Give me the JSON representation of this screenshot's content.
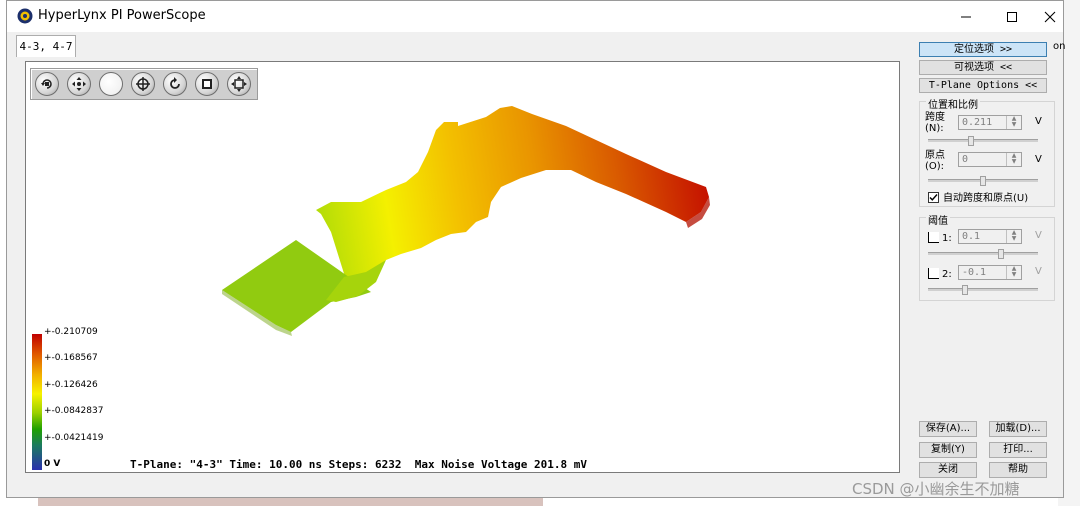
{
  "window": {
    "title": "HyperLynx PI PowerScope"
  },
  "tabs": [
    {
      "label": "4-3, 4-7"
    }
  ],
  "toolbar": {
    "tools": [
      "rotate-icon",
      "pan-icon",
      "blank-icon",
      "move-icon",
      "reset-view-icon",
      "stop-icon",
      "fit-icon"
    ]
  },
  "legend": {
    "labels": [
      "+-0.210709",
      "+-0.168567",
      "+-0.126426",
      "+-0.0842837",
      "+-0.0421419",
      "0 V"
    ]
  },
  "status": {
    "text": "T-Plane: \"4-3\" Time: 10.00 ns Steps: 6232  Max Noise Voltage 201.8 mV"
  },
  "right_panel": {
    "locate_options": "定位选项 >>",
    "visual_options": "可视选项 <<",
    "tplane_options": "T-Plane Options <<",
    "position_group": {
      "title": "位置和比例",
      "span_label": "跨度\n(N):",
      "span_value": "0.211",
      "span_unit": "V",
      "origin_label": "原点\n(O):",
      "origin_value": "0",
      "origin_unit": "V",
      "auto_label": "自动跨度和原点(U)",
      "auto_checked": true
    },
    "threshold_group": {
      "title": "阈值",
      "t1_label": "1:",
      "t1_value": "0.1",
      "t1_unit": "V",
      "t2_label": "2:",
      "t2_value": "-0.1",
      "t2_unit": "V"
    },
    "buttons": {
      "save": "保存(A)...",
      "load": "加载(D)...",
      "copy": "复制(Y)",
      "print": "打印...",
      "close": "关闭",
      "help": "帮助"
    },
    "cut_off_text": "on"
  },
  "watermark": "CSDN @小幽余生不加糖"
}
